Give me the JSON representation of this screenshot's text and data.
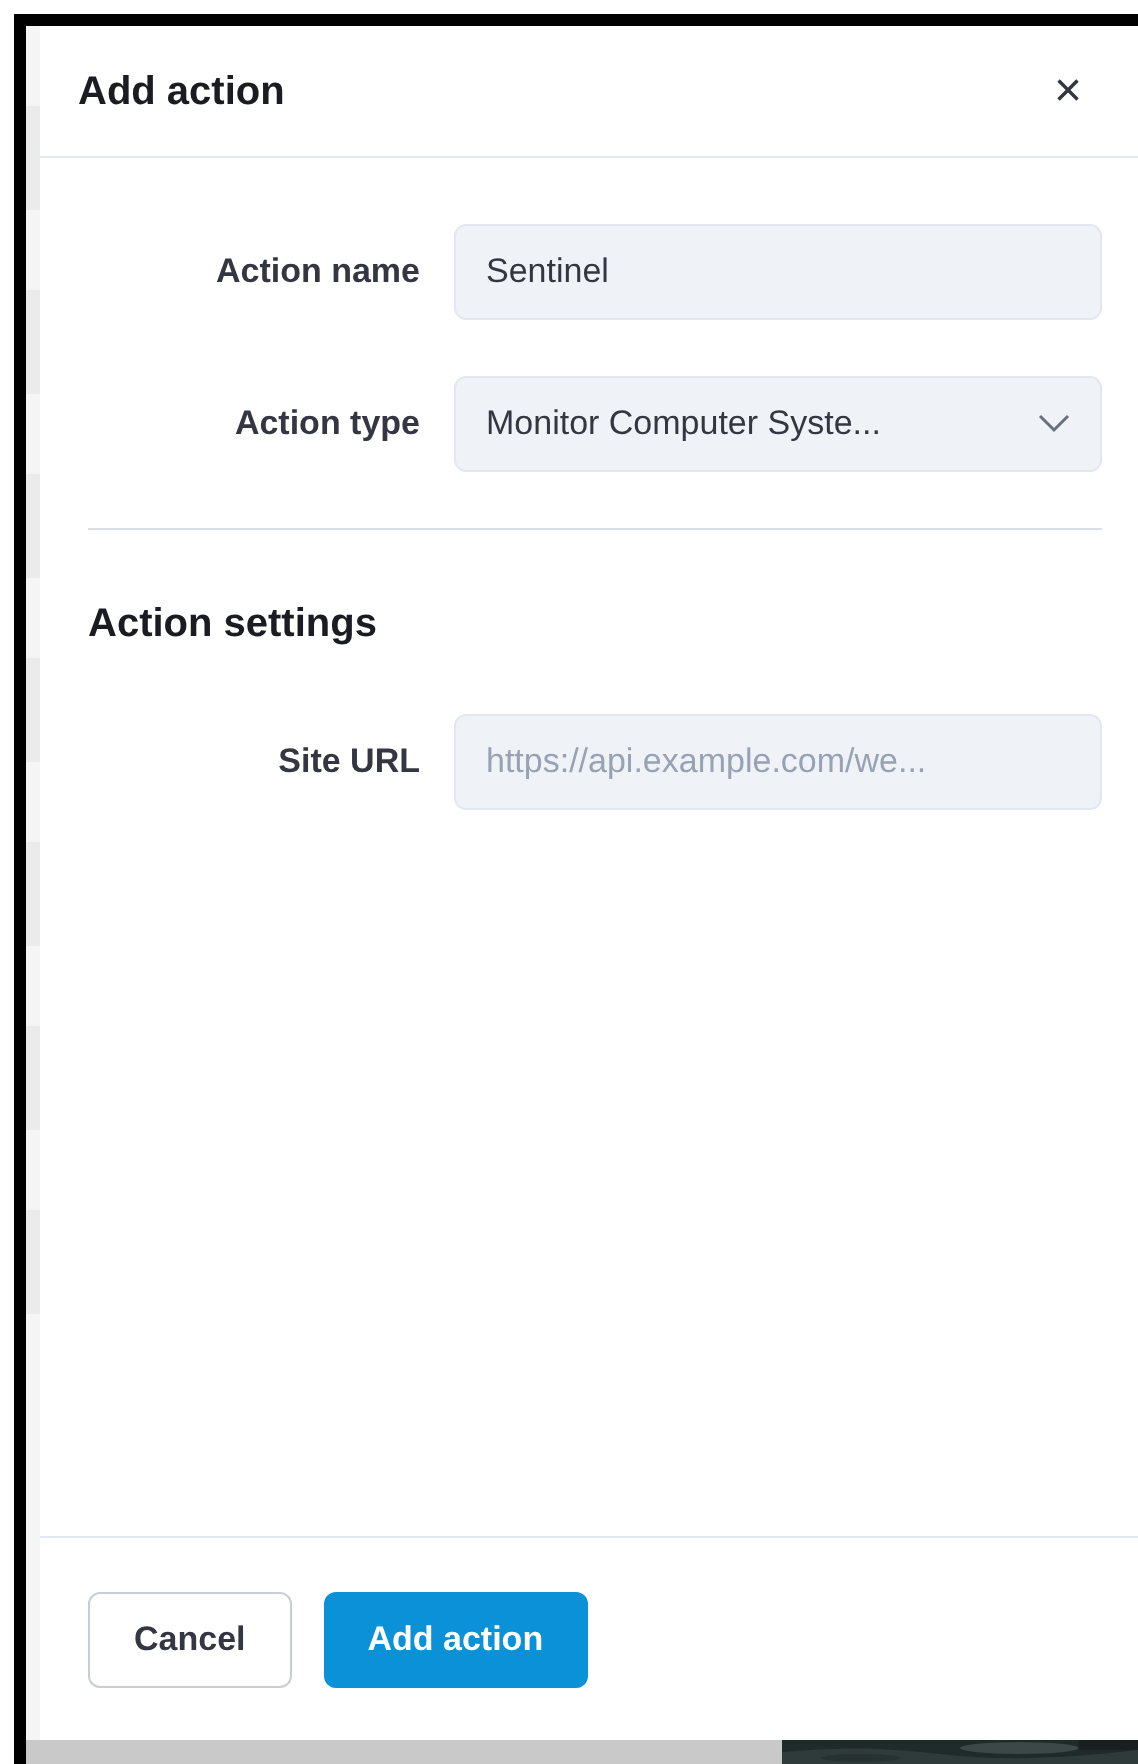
{
  "dialog": {
    "title": "Add action",
    "close": "×"
  },
  "fields": [
    {
      "label": "Action name",
      "kind": "text",
      "value": "Sentinel"
    },
    {
      "label": "Action type",
      "kind": "select",
      "value": "Monitor Computer Syste..."
    }
  ],
  "section": {
    "title": "Action settings",
    "fields": [
      {
        "label": "Site URL",
        "kind": "text",
        "placeholder": "https://api.example.com/we..."
      }
    ]
  },
  "buttons": [
    {
      "label": "Cancel",
      "kind": "secondary"
    },
    {
      "label": "Add action",
      "kind": "primary"
    }
  ]
}
